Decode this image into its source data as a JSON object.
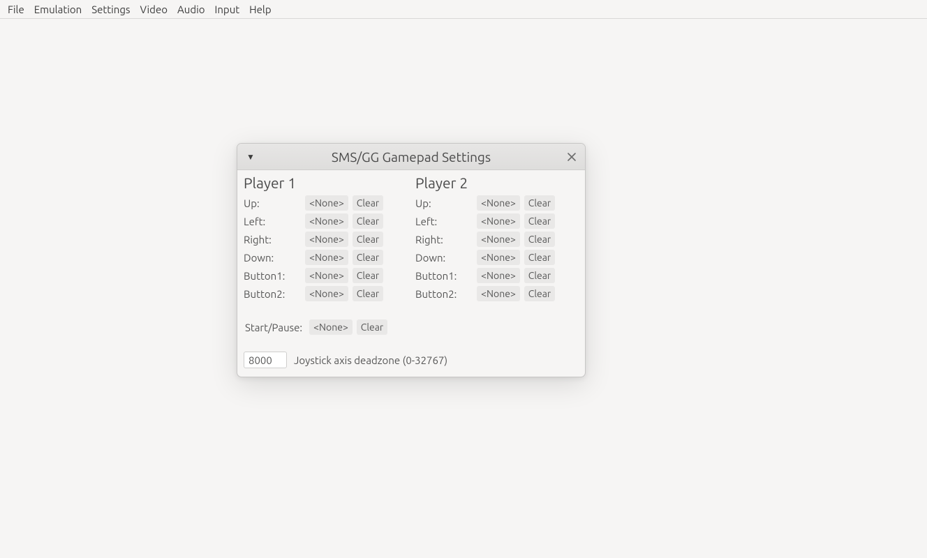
{
  "menubar": {
    "items": [
      "File",
      "Emulation",
      "Settings",
      "Video",
      "Audio",
      "Input",
      "Help"
    ]
  },
  "dialog": {
    "title": "SMS/GG Gamepad Settings",
    "players": [
      {
        "heading": "Player 1",
        "rows": [
          {
            "label": "Up:",
            "binding": "<None>",
            "clear": "Clear"
          },
          {
            "label": "Left:",
            "binding": "<None>",
            "clear": "Clear"
          },
          {
            "label": "Right:",
            "binding": "<None>",
            "clear": "Clear"
          },
          {
            "label": "Down:",
            "binding": "<None>",
            "clear": "Clear"
          },
          {
            "label": "Button1:",
            "binding": "<None>",
            "clear": "Clear"
          },
          {
            "label": "Button2:",
            "binding": "<None>",
            "clear": "Clear"
          }
        ]
      },
      {
        "heading": "Player 2",
        "rows": [
          {
            "label": "Up:",
            "binding": "<None>",
            "clear": "Clear"
          },
          {
            "label": "Left:",
            "binding": "<None>",
            "clear": "Clear"
          },
          {
            "label": "Right:",
            "binding": "<None>",
            "clear": "Clear"
          },
          {
            "label": "Down:",
            "binding": "<None>",
            "clear": "Clear"
          },
          {
            "label": "Button1:",
            "binding": "<None>",
            "clear": "Clear"
          },
          {
            "label": "Button2:",
            "binding": "<None>",
            "clear": "Clear"
          }
        ]
      }
    ],
    "startpause": {
      "label": "Start/Pause:",
      "binding": "<None>",
      "clear": "Clear"
    },
    "deadzone": {
      "value": "8000",
      "label": "Joystick axis deadzone (0-32767)"
    }
  }
}
